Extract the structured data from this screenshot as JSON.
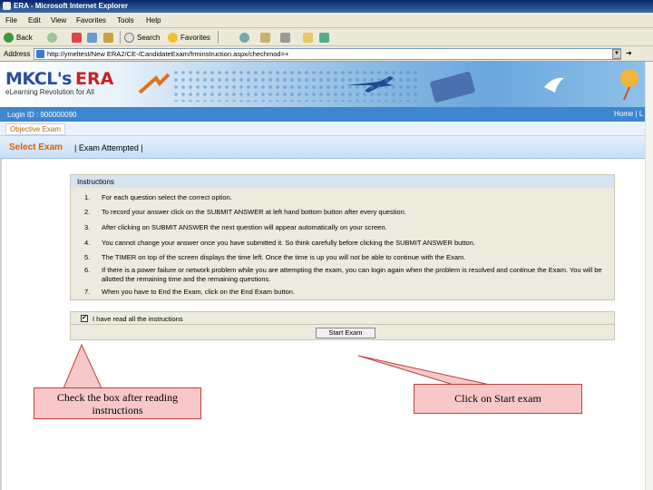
{
  "window": {
    "title": "ERA - Microsoft Internet Explorer"
  },
  "menu": [
    "File",
    "Edit",
    "View",
    "Favorites",
    "Tools",
    "Help"
  ],
  "toolbar": {
    "back": "Back",
    "search": "Search",
    "favorites": "Favorites"
  },
  "address": {
    "label": "Address",
    "url": "http://ymeltest/New ERA2/CE-/CandidateExam/frminstruction.aspx/chechmod=+"
  },
  "banner": {
    "logo_mkcl": "MKCL's",
    "logo_era": "ERA",
    "tagline": "eLearning Revolution for All"
  },
  "login": {
    "text": "Login ID : 900000090",
    "links": "Home | L"
  },
  "tabs": {
    "objective": "Objective Exam"
  },
  "nav": {
    "select_exam": "Select Exam",
    "exam_attempted": "| Exam Attempted |"
  },
  "instructions": {
    "title": "Instructions",
    "items": [
      {
        "num": "1.",
        "text": "For each question select the correct option."
      },
      {
        "num": "2.",
        "text": "To record your answer click on the SUBMIT ANSWER at left hand bottom button after every question."
      },
      {
        "num": "3.",
        "text": "After clicking on SUBMIT ANSWER the next question will appear automatically on your screen."
      },
      {
        "num": "4.",
        "text": "You cannot change your answer once you have submitted it. So think carefully before clicking the SUBMIT ANSWER button."
      },
      {
        "num": "5.",
        "text": "The TIMER on top of the screen displays the time left. Once the time is up you will not be able to continue with the Exam."
      },
      {
        "num": "6.",
        "text": "If there is a power failure or network problem while you are attempting the exam, you can login again when the problem is resolved and continue the Exam. You will be allotted the remaining time and the remaining questions."
      },
      {
        "num": "7.",
        "text": "When you have to End the Exam, click on the End Exam button."
      }
    ]
  },
  "agree": {
    "label": "I have read all the instructions",
    "checked": "✔"
  },
  "start_button": "Start Exam",
  "callouts": {
    "checkbox": "Check the box after reading instructions",
    "start": "Click on Start exam"
  },
  "colors": {
    "banner_blue": "#3e86cf",
    "accent_orange": "#d4620a",
    "callout_fill": "#f8c8c8",
    "callout_border": "#c04040"
  }
}
